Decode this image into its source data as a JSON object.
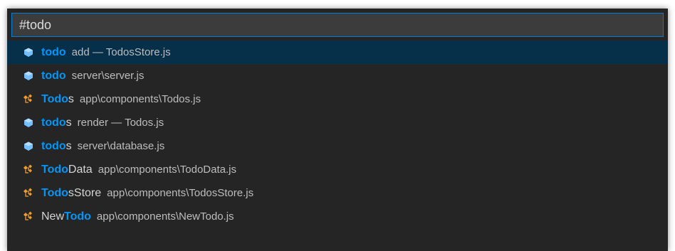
{
  "quick_open": {
    "input_value": "#todo",
    "highlight_color": "#0097fb",
    "results": [
      {
        "icon": "variable-icon",
        "label_pre": "",
        "label_match": "todo",
        "label_post": "",
        "description": "add — TodosStore.js",
        "selected": true
      },
      {
        "icon": "variable-icon",
        "label_pre": "",
        "label_match": "todo",
        "label_post": "",
        "description": "server\\server.js",
        "selected": false
      },
      {
        "icon": "class-icon",
        "label_pre": "",
        "label_match": "Todo",
        "label_post": "s",
        "description": "app\\components\\Todos.js",
        "selected": false
      },
      {
        "icon": "variable-icon",
        "label_pre": "",
        "label_match": "todo",
        "label_post": "s",
        "description": "render — Todos.js",
        "selected": false
      },
      {
        "icon": "variable-icon",
        "label_pre": "",
        "label_match": "todo",
        "label_post": "s",
        "description": "server\\database.js",
        "selected": false
      },
      {
        "icon": "class-icon",
        "label_pre": "",
        "label_match": "Todo",
        "label_post": "Data",
        "description": "app\\components\\TodoData.js",
        "selected": false
      },
      {
        "icon": "class-icon",
        "label_pre": "",
        "label_match": "Todo",
        "label_post": "sStore",
        "description": "app\\components\\TodosStore.js",
        "selected": false
      },
      {
        "icon": "class-icon",
        "label_pre": "New",
        "label_match": "Todo",
        "label_post": "",
        "description": "app\\components\\NewTodo.js",
        "selected": false
      }
    ]
  }
}
